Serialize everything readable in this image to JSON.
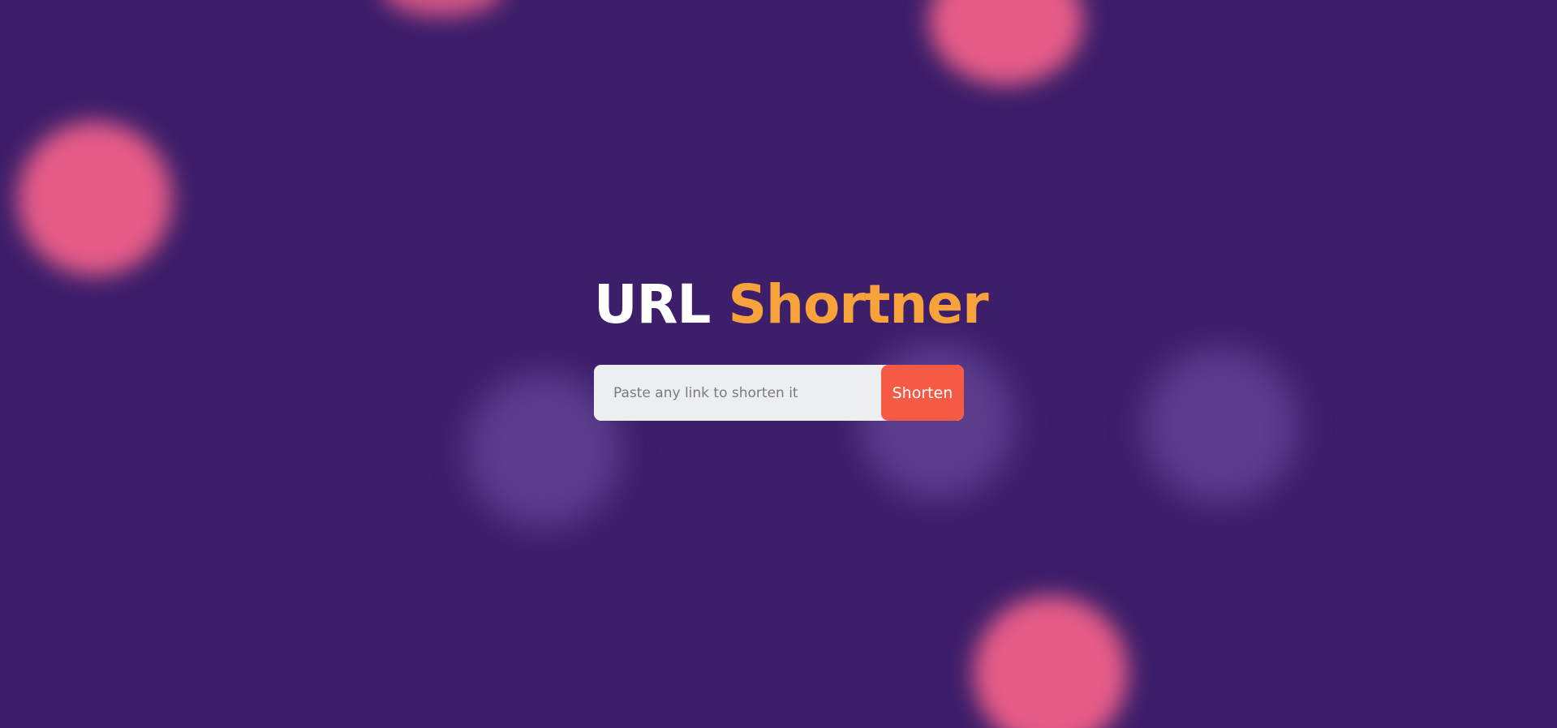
{
  "header": {
    "title_part1": "URL",
    "title_part2": "Shortner"
  },
  "form": {
    "placeholder": "Paste any link to shorten it",
    "value": "",
    "button_label": "Shorten"
  },
  "colors": {
    "background": "#3d1e6a",
    "accent_orange": "#f7a23b",
    "button": "#f65a45",
    "blob_pink": "#e65c88",
    "blob_lavender": "#5b3d8c"
  }
}
